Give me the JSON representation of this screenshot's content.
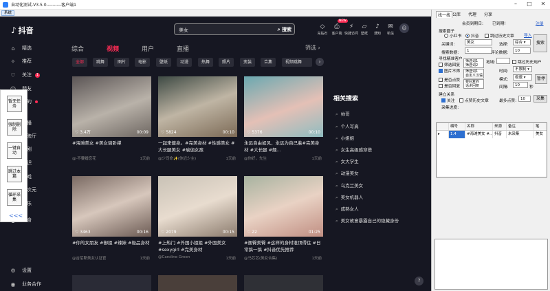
{
  "window": {
    "title": "自动化测试-V3.5.0----------客户端1",
    "sys_menu": "系统"
  },
  "douyin": {
    "brand": "抖音",
    "nav": [
      {
        "icon": "home",
        "label": "精选"
      },
      {
        "icon": "recommend",
        "label": "推荐"
      },
      {
        "icon": "follow",
        "label": "关注",
        "badge": "1"
      },
      {
        "icon": "friend",
        "label": "朋友"
      },
      {
        "icon": "mine",
        "label": "我的"
      },
      {
        "icon": "live",
        "label": "直播"
      },
      {
        "icon": "tv",
        "label": "放映厅"
      },
      {
        "icon": "short",
        "label": "短剧"
      },
      {
        "icon": "knowledge",
        "label": "知识"
      },
      {
        "icon": "game",
        "label": "游戏"
      },
      {
        "icon": "secondary",
        "label": "二次元"
      },
      {
        "icon": "music",
        "label": "音乐"
      },
      {
        "icon": "food",
        "label": "美食"
      }
    ],
    "bottom_nav": [
      {
        "label": "设置"
      },
      {
        "label": "业务合作"
      }
    ],
    "float_tools": [
      "暂无任务",
      "强制删除",
      "一键自动",
      "跳过本篇",
      "循环采集"
    ],
    "float_collapse": "<<<",
    "search": {
      "value": "美女",
      "button": "搜索"
    },
    "header_icons": [
      "充钻石",
      "客户端",
      "快捷访问",
      "壁纸",
      "通知",
      "私信",
      "投稿"
    ],
    "new_tag": "NEW",
    "tabs": [
      "综合",
      "视频",
      "用户",
      "直播"
    ],
    "active_tab": "视频",
    "filter": "筛选",
    "chips": [
      "全部",
      "跳舞",
      "图片",
      "电影",
      "壁纸",
      "动漫",
      "热舞",
      "照片",
      "变装",
      "合集",
      "视频跳舞"
    ],
    "videos": [
      {
        "likes": "3.4万",
        "duration": "00:09",
        "title": "#海滩美女 #美女骑卧撑",
        "author": "@·不要婚恋花",
        "date": "1天前"
      },
      {
        "likes": "5824",
        "duration": "00:10",
        "title": "一起来健身。#完美身材 #性感美女 #大长腿美女 #瑜伽女孩",
        "author": "@少司命✨(你迟少主)",
        "date": "1天前"
      },
      {
        "likes": "5376",
        "duration": "00:10",
        "title": "永远自由如风，永远为自己着#完美身材 #大长腿 #翘…",
        "author": "@你好，先生",
        "date": "1天前"
      },
      {
        "likes": "3463",
        "duration": "00:16",
        "title": "#你的女朋友 #御姐 #辣妹 #极品身材",
        "author": "@吉尼斯美女认证官",
        "date": "1天前"
      },
      {
        "likes": "2079",
        "duration": "00:15",
        "title": "#上热门 #外国小姐姐 #外国美女 #sexygirl #完美身材",
        "author": "@Caroline Green",
        "date": "1天前"
      },
      {
        "likes": "22",
        "duration": "01:25",
        "title": "#翘臀美臀 #这样的身材谁顶得住 #日常搞一搞 #抖音优先推荐",
        "author": "@马芯芯(美女合集)",
        "date": "1天前"
      }
    ],
    "related_title": "相关搜索",
    "related": [
      "帅哥",
      "个人写真",
      "小姐姐",
      "女生高级感穿搭",
      "女大学生",
      "动漫美女",
      "乌克兰美女",
      "美女机器人",
      "成熟女人",
      "美女故意暴露自己的隐藏身份"
    ]
  },
  "panel": {
    "tabs": [
      "找一找",
      "公库",
      "代理",
      "分享"
    ],
    "member_expiry_label": "会员到期日:",
    "member_expiry_value": "已到期!",
    "register": "注册",
    "search_circle_label": "搜索圈子",
    "platforms": [
      "小红书",
      "抖音"
    ],
    "history_label": "跳过历史文章",
    "import": "导入",
    "keyword_label": "关键词:",
    "keyword_value": "美女",
    "select_label": "选择:",
    "select_value": "综合",
    "search_btn": "搜索",
    "post_count_label": "搜索数据:",
    "post_count_value": "1",
    "comment_count_label": "评论数据:",
    "comment_count_value": "10",
    "wait_label": "寻找精准客户",
    "filter_reply": "筛选回复",
    "filter_reply_hint": "筛选词1\n筛选词2",
    "region_label": "地域:",
    "skip_history": "跳过历史用户",
    "image_dont": "图片不筛",
    "image_hint": "筛选词1\n自定义汉语",
    "time_label": "时间:",
    "time_value": "不限制",
    "is_like": "是否点赞",
    "like_hint": "要回复的\n话术回复",
    "mode_label": "模式:",
    "mode_value": "极速",
    "is_reply": "是否回复",
    "reply_hint": "回复话术\n自定义汉语",
    "interval_label": "间隔:",
    "interval_value": "10",
    "interval_unit": "秒",
    "pause_btn": "暂停",
    "relation_label": "建立关系",
    "follow_label": "关注",
    "collect_label": "点赞历史文章",
    "max_points_label": "最多点赞:",
    "max_points_value": "10",
    "collect_btn": "采集",
    "progress_label": "采集进度:",
    "columns": [
      "编号",
      "名称",
      "来源",
      "备注",
      "笔"
    ],
    "rows": [
      {
        "id": "1.4",
        "name": "#海滩美女 #...",
        "source": "抖音",
        "note": "未采集",
        "extra": "美女"
      }
    ]
  }
}
